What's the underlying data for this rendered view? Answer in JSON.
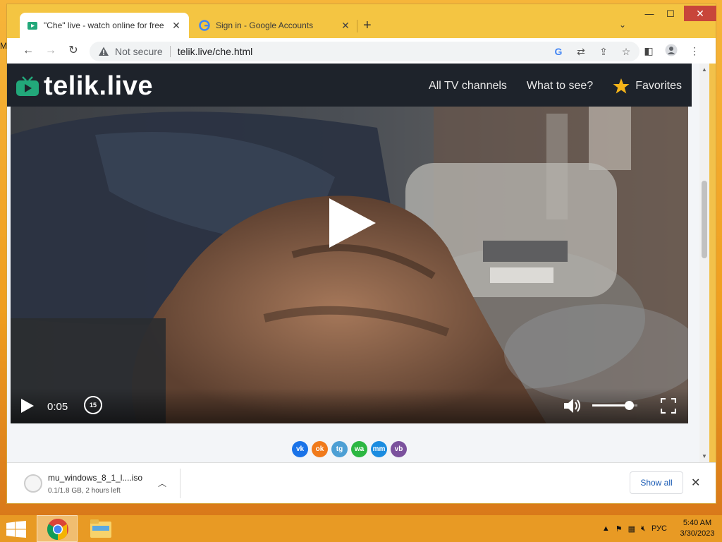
{
  "desktop": {
    "edge_letter": "M"
  },
  "tabs": [
    {
      "title": "\"Che\" live - watch online for free",
      "active": true
    },
    {
      "title": "Sign in - Google Accounts",
      "active": false
    }
  ],
  "window_controls": {
    "minimize": "—",
    "maximize": "☐",
    "close": "✕"
  },
  "toolbar": {
    "security_label": "Not secure",
    "url": "telik.live/che.html"
  },
  "site": {
    "logo_text": "telik.live",
    "nav": [
      "All TV channels",
      "What to see?",
      "Favorites"
    ]
  },
  "player": {
    "time": "0:05",
    "rewind_label": "15",
    "volume_fraction": 0.82
  },
  "share_icons": [
    {
      "name": "vk",
      "label": "vk",
      "color": "#1a73e8"
    },
    {
      "name": "odnoklassniki",
      "label": "ok",
      "color": "#f07a1b"
    },
    {
      "name": "telegram",
      "label": "tg",
      "color": "#4d9fd4"
    },
    {
      "name": "whatsapp",
      "label": "wa",
      "color": "#2cb742"
    },
    {
      "name": "moimir",
      "label": "mm",
      "color": "#1b8ce0"
    },
    {
      "name": "viber",
      "label": "vb",
      "color": "#7b519d"
    }
  ],
  "download": {
    "file_name": "mu_windows_8_1_l....iso",
    "status": "0.1/1.8 GB, 2 hours left",
    "show_all": "Show all"
  },
  "taskbar": {
    "language": "РУС",
    "time": "5:40 AM",
    "date": "3/30/2023"
  },
  "colors": {
    "chrome_frame": "#f4c542",
    "site_header": "#1e232b",
    "logo_green": "#22a87a",
    "star": "#f5b419"
  }
}
